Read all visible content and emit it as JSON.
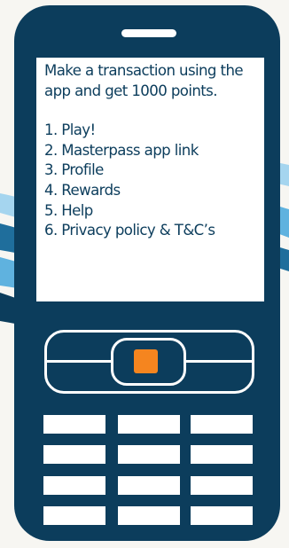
{
  "screen": {
    "intro": "Make a transaction using the app and get 1000 points.",
    "menu_items": [
      "1. Play!",
      "2. Masterpass app link",
      "3. Profile",
      "4. Rewards",
      "5. Help",
      "6. Privacy policy & T&C’s"
    ]
  },
  "colors": {
    "phone_body": "#0c3d5c",
    "screen_bg": "#ffffff",
    "select_dot": "#f5851f",
    "wave_light": "#a5d5ef",
    "wave_dark": "#0c3d5c"
  }
}
